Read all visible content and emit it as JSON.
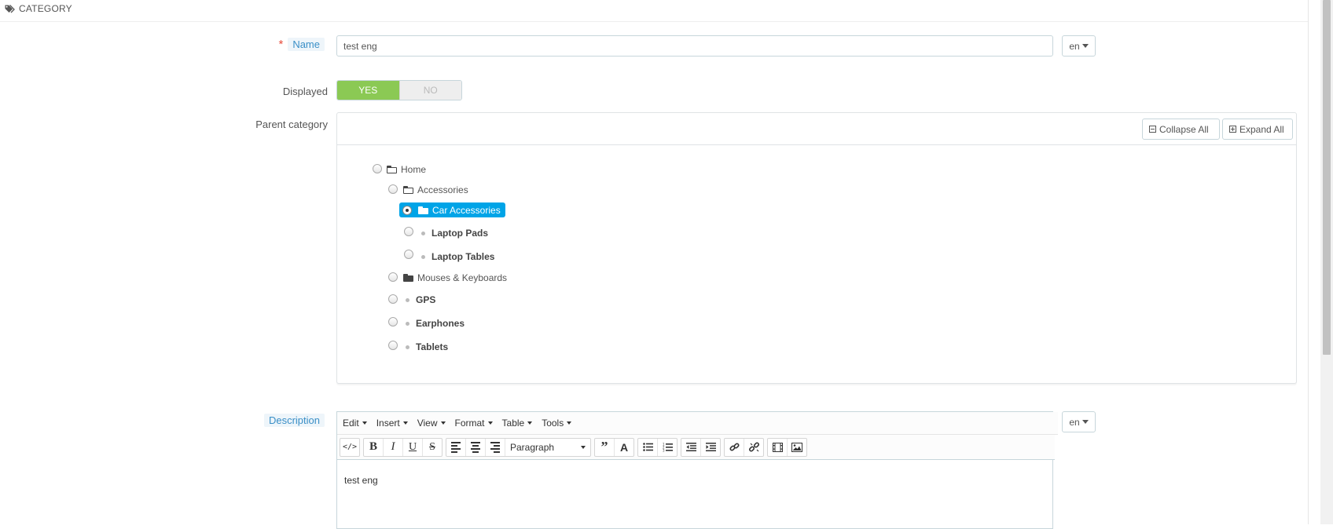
{
  "panel": {
    "title": "CATEGORY",
    "icon": "tags-icon"
  },
  "form": {
    "name": {
      "label": "Name",
      "value": "test eng",
      "lang": "en"
    },
    "displayed": {
      "label": "Displayed",
      "yes": "YES",
      "no": "NO",
      "value": "YES"
    },
    "parent_category": {
      "label": "Parent category",
      "collapse_all": "Collapse All",
      "expand_all": "Expand All",
      "tree": [
        {
          "label": "Home",
          "type": "folder-open",
          "selected": false
        },
        {
          "label": "Accessories",
          "type": "folder-open",
          "selected": false
        },
        {
          "label": "Car Accessories",
          "type": "folder",
          "selected": true
        },
        {
          "label": "Laptop Pads",
          "type": "leaf",
          "selected": false
        },
        {
          "label": "Laptop Tables",
          "type": "leaf",
          "selected": false
        },
        {
          "label": "Mouses & Keyboards",
          "type": "folder",
          "selected": false
        },
        {
          "label": "GPS",
          "type": "leaf",
          "selected": false
        },
        {
          "label": "Earphones",
          "type": "leaf",
          "selected": false
        },
        {
          "label": "Tablets",
          "type": "leaf",
          "selected": false
        }
      ]
    },
    "description": {
      "label": "Description",
      "lang": "en",
      "menus": [
        "Edit",
        "Insert",
        "View",
        "Format",
        "Table",
        "Tools"
      ],
      "format_select": "Paragraph",
      "content": "test eng"
    }
  }
}
